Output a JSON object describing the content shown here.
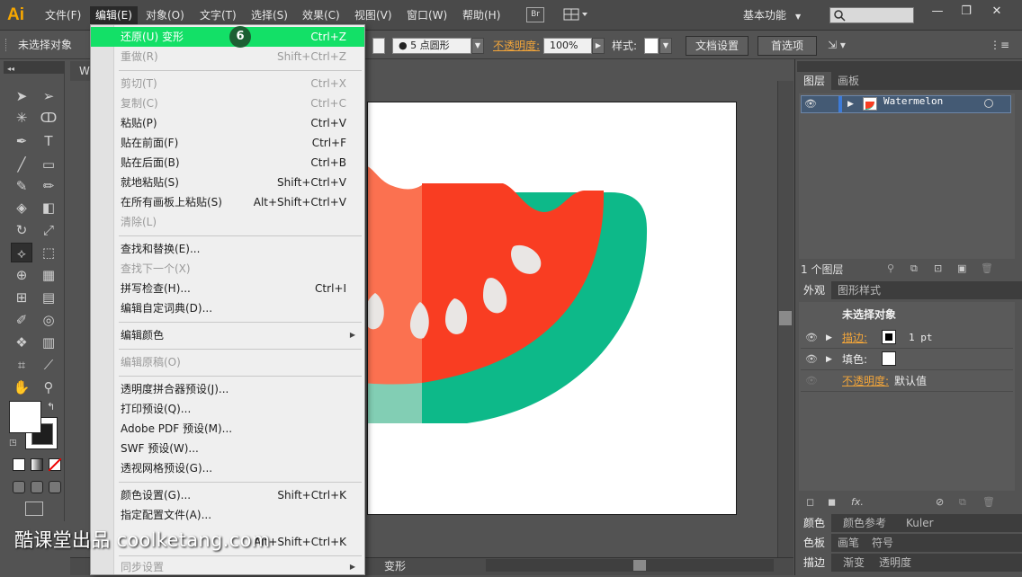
{
  "app": {
    "logo": "Ai"
  },
  "menubar": {
    "items": [
      "文件(F)",
      "编辑(E)",
      "对象(O)",
      "文字(T)",
      "选择(S)",
      "效果(C)",
      "视图(V)",
      "窗口(W)",
      "帮助(H)"
    ],
    "bridge_label": "Br",
    "workspace": "基本功能",
    "window_buttons": [
      "—",
      "❐",
      "✕"
    ]
  },
  "controlbar": {
    "selection_status": "未选择对象",
    "brush_value": "5 点圆形",
    "opacity_label": "不透明度:",
    "opacity_value": "100%",
    "style_label": "样式:",
    "doc_setup_button": "文档设置",
    "preferences_button": "首选项"
  },
  "document": {
    "tab_label": "W",
    "status_text": "变形"
  },
  "edit_menu": {
    "items": [
      {
        "label": "还原(U) 变形",
        "shortcut": "Ctrl+Z",
        "state": "highlighted"
      },
      {
        "label": "重做(R)",
        "shortcut": "Shift+Ctrl+Z",
        "state": "disabled"
      },
      {
        "label": "剪切(T)",
        "shortcut": "Ctrl+X",
        "state": "disabled"
      },
      {
        "label": "复制(C)",
        "shortcut": "Ctrl+C",
        "state": "disabled"
      },
      {
        "label": "粘贴(P)",
        "shortcut": "Ctrl+V",
        "state": "enabled"
      },
      {
        "label": "贴在前面(F)",
        "shortcut": "Ctrl+F",
        "state": "enabled"
      },
      {
        "label": "贴在后面(B)",
        "shortcut": "Ctrl+B",
        "state": "enabled"
      },
      {
        "label": "就地粘贴(S)",
        "shortcut": "Shift+Ctrl+V",
        "state": "enabled"
      },
      {
        "label": "在所有画板上粘贴(S)",
        "shortcut": "Alt+Shift+Ctrl+V",
        "state": "enabled"
      },
      {
        "label": "清除(L)",
        "shortcut": "",
        "state": "disabled"
      },
      {
        "label": "查找和替换(E)...",
        "shortcut": "",
        "state": "enabled"
      },
      {
        "label": "查找下一个(X)",
        "shortcut": "",
        "state": "disabled"
      },
      {
        "label": "拼写检查(H)...",
        "shortcut": "Ctrl+I",
        "state": "enabled"
      },
      {
        "label": "编辑自定词典(D)...",
        "shortcut": "",
        "state": "enabled"
      },
      {
        "label": "编辑颜色",
        "shortcut": "",
        "state": "submenu"
      },
      {
        "label": "编辑原稿(O)",
        "shortcut": "",
        "state": "disabled"
      },
      {
        "label": "透明度拼合器预设(J)...",
        "shortcut": "",
        "state": "enabled"
      },
      {
        "label": "打印预设(Q)...",
        "shortcut": "",
        "state": "enabled"
      },
      {
        "label": "Adobe PDF 预设(M)...",
        "shortcut": "",
        "state": "enabled"
      },
      {
        "label": "SWF 预设(W)...",
        "shortcut": "",
        "state": "enabled"
      },
      {
        "label": "透视网格预设(G)...",
        "shortcut": "",
        "state": "enabled"
      },
      {
        "label": "颜色设置(G)...",
        "shortcut": "Shift+Ctrl+K",
        "state": "enabled"
      },
      {
        "label": "指定配置文件(A)...",
        "shortcut": "",
        "state": "enabled"
      },
      {
        "label": "",
        "shortcut": "Alt+Shift+Ctrl+K",
        "state": "enabled"
      },
      {
        "label": "同步设置",
        "shortcut": "",
        "state": "submenu-disabled"
      }
    ],
    "step_badge": "6"
  },
  "layers_panel": {
    "tabs": [
      "图层",
      "画板"
    ],
    "layer_name": "Watermelon",
    "layer_count": "1 个图层"
  },
  "appearance_panel": {
    "tabs": [
      "外观",
      "图形样式"
    ],
    "title": "未选择对象",
    "stroke_label": "描边:",
    "stroke_value": "1 pt",
    "fill_label": "填色:",
    "opacity_label": "不透明度:",
    "opacity_value": "默认值"
  },
  "bottom_panels": {
    "row1": [
      "颜色",
      "颜色参考",
      "Kuler"
    ],
    "row2": [
      "色板",
      "画笔",
      "符号"
    ],
    "row3": [
      "描边",
      "渐变",
      "透明度"
    ]
  },
  "watermark": "酷课堂出品 coolketang.com",
  "colors": {
    "accent_highlight": "#13e067",
    "watermelon_flesh_dark": "#f93d22",
    "watermelon_flesh_light": "#fb7150",
    "watermelon_rind_dark": "#0db989",
    "watermelon_rind_light": "#82ceb4",
    "seed": "#e9e6e4"
  }
}
